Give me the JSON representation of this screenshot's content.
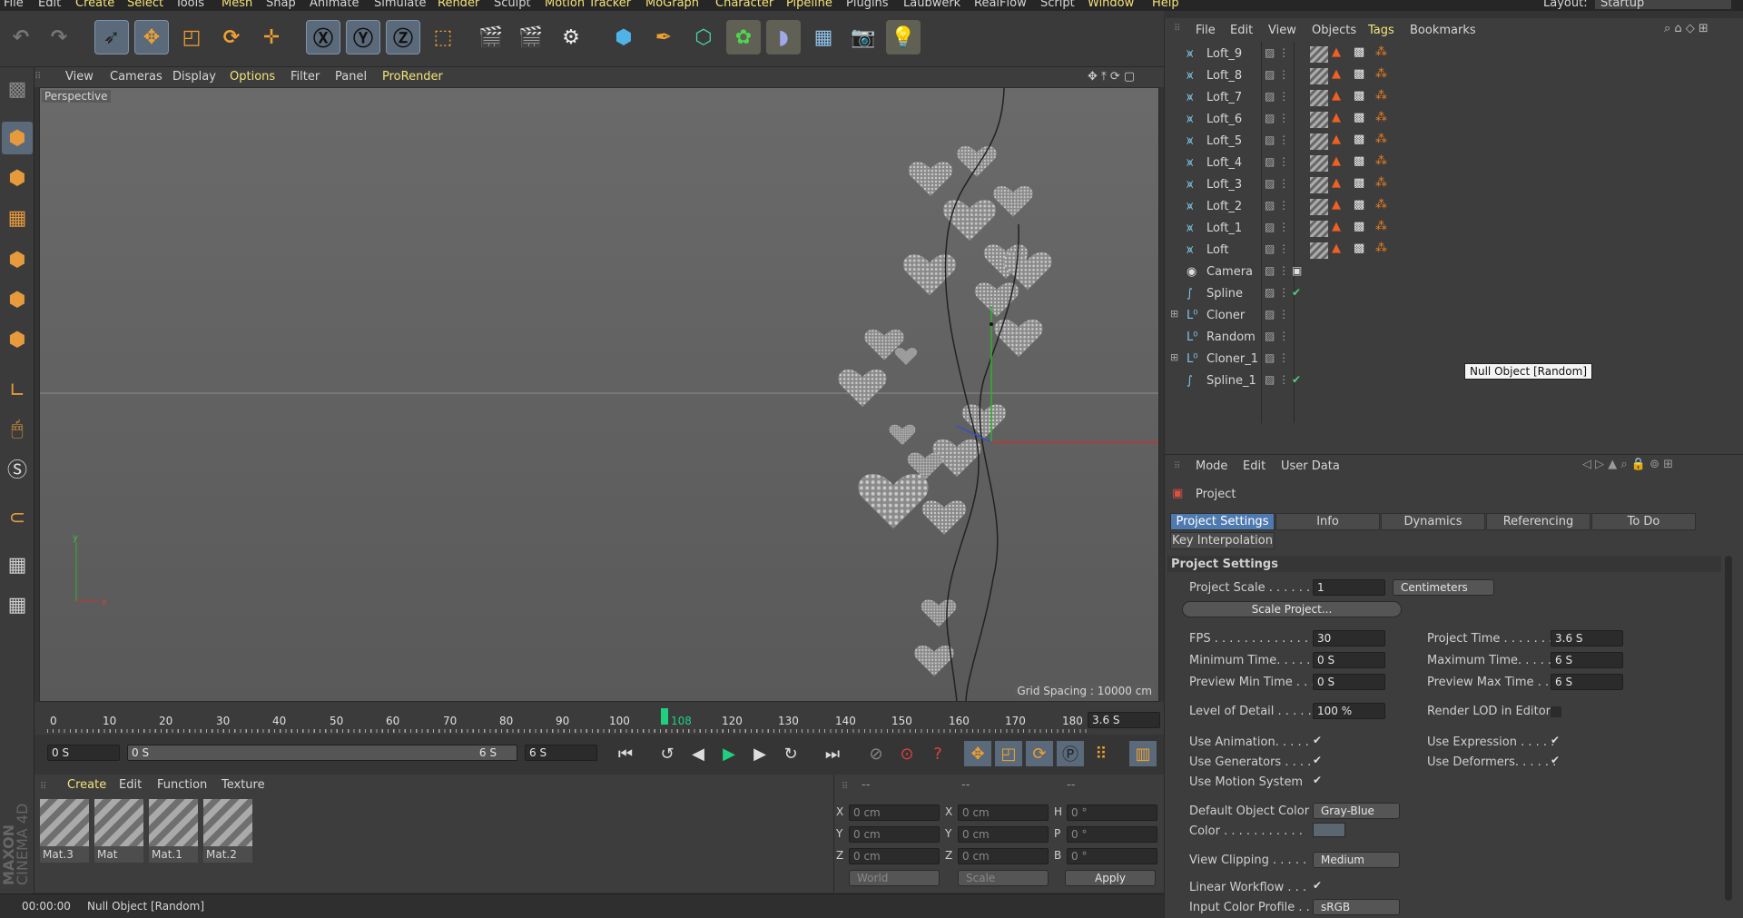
{
  "menubar": {
    "items": [
      "File",
      "Edit",
      "Create",
      "Select",
      "Tools",
      "Mesh",
      "Snap",
      "Animate",
      "Simulate",
      "Render",
      "Sculpt",
      "Motion Tracker",
      "MoGraph",
      "Character",
      "Pipeline",
      "Plugins",
      "Laubwerk",
      "RealFlow",
      "Script",
      "Window",
      "Help"
    ],
    "layout_label": "Layout:",
    "layout_value": "Startup"
  },
  "viewport": {
    "menu": [
      "View",
      "Cameras",
      "Display",
      "Options",
      "Filter",
      "Panel",
      "ProRender"
    ],
    "label": "Perspective",
    "grid_spacing": "Grid Spacing : 10000 cm"
  },
  "timeline": {
    "ticks": [
      "0",
      "10",
      "20",
      "30",
      "40",
      "50",
      "60",
      "70",
      "80",
      "90",
      "100",
      "108",
      "120",
      "130",
      "140",
      "150",
      "160",
      "170",
      "180"
    ],
    "current_frame": "108",
    "current_time": "3.6 S"
  },
  "transport": {
    "start": "0 S",
    "range_start": "0 S",
    "range_end": "6 S",
    "end": "6 S"
  },
  "materials": {
    "menu": [
      "Create",
      "Edit",
      "Function",
      "Texture"
    ],
    "items": [
      "Mat.3",
      "Mat",
      "Mat.1",
      "Mat.2"
    ]
  },
  "coords": {
    "headers": [
      "--",
      "--",
      "--"
    ],
    "rows": [
      {
        "a": "X",
        "av": "0 cm",
        "b": "X",
        "bv": "0 cm",
        "c": "H",
        "cv": "0 °"
      },
      {
        "a": "Y",
        "av": "0 cm",
        "b": "Y",
        "bv": "0 cm",
        "c": "P",
        "cv": "0 °"
      },
      {
        "a": "Z",
        "av": "0 cm",
        "b": "Z",
        "bv": "0 cm",
        "c": "B",
        "cv": "0 °"
      }
    ],
    "world": "World",
    "scale": "Scale",
    "apply": "Apply"
  },
  "statusbar": {
    "time": "00:00:00",
    "message": "Null Object [Random]",
    "brand1": "MAXON",
    "brand2": "CINEMA 4D"
  },
  "objmgr": {
    "menu": [
      "File",
      "Edit",
      "View",
      "Objects",
      "Tags",
      "Bookmarks"
    ],
    "objects": [
      {
        "name": "Loft_9",
        "type": "loft"
      },
      {
        "name": "Loft_8",
        "type": "loft"
      },
      {
        "name": "Loft_7",
        "type": "loft"
      },
      {
        "name": "Loft_6",
        "type": "loft"
      },
      {
        "name": "Loft_5",
        "type": "loft"
      },
      {
        "name": "Loft_4",
        "type": "loft"
      },
      {
        "name": "Loft_3",
        "type": "loft"
      },
      {
        "name": "Loft_2",
        "type": "loft"
      },
      {
        "name": "Loft_1",
        "type": "loft"
      },
      {
        "name": "Loft",
        "type": "loft"
      },
      {
        "name": "Camera",
        "type": "camera"
      },
      {
        "name": "Spline",
        "type": "spline"
      },
      {
        "name": "Cloner",
        "type": "null"
      },
      {
        "name": "Random",
        "type": "null"
      },
      {
        "name": "Cloner_1",
        "type": "null"
      },
      {
        "name": "Spline_1",
        "type": "spline"
      }
    ],
    "tooltip": "Null Object [Random]"
  },
  "attr": {
    "menu": [
      "Mode",
      "Edit",
      "User Data"
    ],
    "title": "Project",
    "tabs": [
      "Project Settings",
      "Info",
      "Dynamics",
      "Referencing",
      "To Do"
    ],
    "tab2": "Key Interpolation",
    "section": "Project Settings",
    "project_scale_label": "Project Scale . . . . . .",
    "project_scale": "1",
    "unit": "Centimeters",
    "scale_project": "Scale Project...",
    "fps_label": "FPS . . . . . . . . . . . . . .",
    "fps": "30",
    "project_time_label": "Project Time . . . . . . . .",
    "project_time": "3.6 S",
    "min_time_label": "Minimum Time. . . . .",
    "min_time": "0 S",
    "max_time_label": "Maximum Time. . . . . .",
    "max_time": "6 S",
    "prev_min_label": "Preview Min Time . . .",
    "prev_min": "0 S",
    "prev_max_label": "Preview Max Time . . .",
    "prev_max": "6 S",
    "lod_label": "Level of Detail . . . . .",
    "lod": "100 %",
    "render_lod_label": "Render LOD in Editor",
    "use_anim": "Use Animation. . . . .",
    "use_expr": "Use Expression . . . . .",
    "use_gen": "Use Generators . . . .",
    "use_def": "Use Deformers. . . . . .",
    "use_motion": "Use Motion System",
    "def_color_label": "Default Object Color",
    "def_color": "Gray-Blue",
    "color_label": "Color . . . . . . . . . . .",
    "clipping_label": "View Clipping . . . . .",
    "clipping": "Medium",
    "linear_label": "Linear Workflow . . .",
    "input_profile_label": "Input Color Profile . .",
    "input_profile": "sRGB"
  }
}
